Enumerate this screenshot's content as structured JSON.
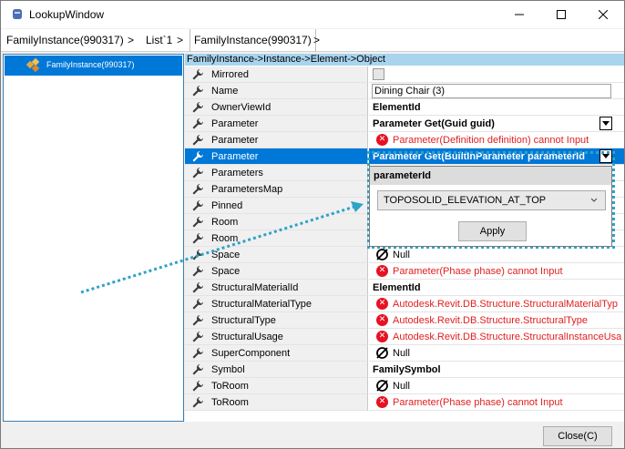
{
  "window": {
    "title": "LookupWindow",
    "minimize_glyph": "—",
    "maximize_glyph": "☐",
    "close_glyph": "✕"
  },
  "breadcrumb": {
    "items": [
      "FamilyInstance(990317)",
      "List`1",
      "FamilyInstance(990317)"
    ],
    "separator": ">"
  },
  "tree": {
    "items": [
      {
        "label": "FamilyInstance(990317)",
        "icon": "family-instance-icon"
      }
    ]
  },
  "grid": {
    "header": "FamilyInstance->Instance->Element->Object",
    "rows": [
      {
        "name": "Mirrored",
        "kind": "checkbox",
        "value": ""
      },
      {
        "name": "Name",
        "kind": "text",
        "value": "Dining Chair (3)"
      },
      {
        "name": "OwnerViewId",
        "kind": "bold",
        "value": "ElementId"
      },
      {
        "name": "Parameter",
        "kind": "combo",
        "value": "Parameter Get(Guid guid)"
      },
      {
        "name": "Parameter",
        "kind": "error",
        "value": "Parameter(Definition definition) cannot Input"
      },
      {
        "name": "Parameter",
        "kind": "combo-selected",
        "value": "Parameter Get(BuiltInParameter parameterId"
      },
      {
        "name": "Parameters",
        "kind": "none",
        "value": ""
      },
      {
        "name": "ParametersMap",
        "kind": "none",
        "value": ""
      },
      {
        "name": "Pinned",
        "kind": "none",
        "value": ""
      },
      {
        "name": "Room",
        "kind": "none",
        "value": ""
      },
      {
        "name": "Room",
        "kind": "none",
        "value": ""
      },
      {
        "name": "Space",
        "kind": "null",
        "value": "Null"
      },
      {
        "name": "Space",
        "kind": "error",
        "value": "Parameter(Phase phase) cannot Input"
      },
      {
        "name": "StructuralMaterialId",
        "kind": "bold",
        "value": "ElementId"
      },
      {
        "name": "StructuralMaterialType",
        "kind": "error",
        "value": "Autodesk.Revit.DB.Structure.StructuralMaterialTyp"
      },
      {
        "name": "StructuralType",
        "kind": "error",
        "value": "Autodesk.Revit.DB.Structure.StructuralType"
      },
      {
        "name": "StructuralUsage",
        "kind": "error",
        "value": "Autodesk.Revit.DB.Structure.StructuralInstanceUsa"
      },
      {
        "name": "SuperComponent",
        "kind": "null",
        "value": "Null"
      },
      {
        "name": "Symbol",
        "kind": "bold",
        "value": "FamilySymbol"
      },
      {
        "name": "ToRoom",
        "kind": "null",
        "value": "Null"
      },
      {
        "name": "ToRoom",
        "kind": "error",
        "value": "Parameter(Phase phase) cannot Input"
      }
    ]
  },
  "popup": {
    "title": "parameterId",
    "selected_option": "TOPOSOLID_ELEVATION_AT_TOP",
    "apply_label": "Apply"
  },
  "footer": {
    "close_label": "Close(C)"
  },
  "colors": {
    "selection": "#0078d7",
    "header": "#a8d4ee",
    "error": "#e02020",
    "highlight_outline": "#2ea3c6"
  }
}
